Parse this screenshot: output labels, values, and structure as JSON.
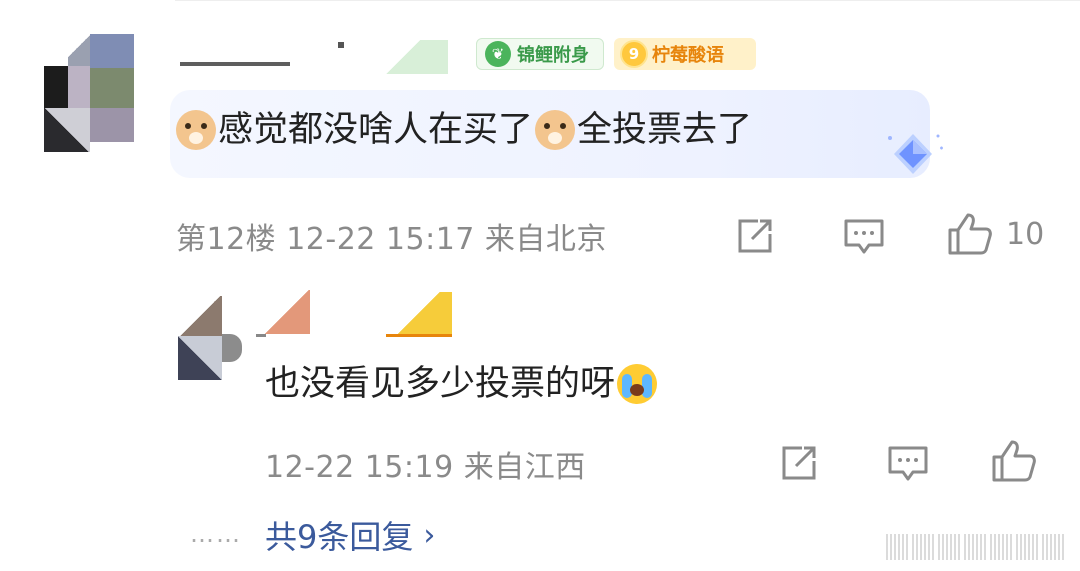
{
  "comment": {
    "badges": {
      "koi_label": "锦鲤附身",
      "koi_icon": "koi-leaf-icon",
      "lemon_level": "9",
      "lemon_label": "柠莓酸语"
    },
    "text_part1": "感觉都没啥人在买了",
    "text_part2": "全投票去了",
    "emoji": "dog-emoji",
    "meta": "第12楼 12-22 15:17 来自北京",
    "like_count": "10"
  },
  "reply": {
    "text": "也没看见多少投票的呀",
    "emoji": "loudly-crying-emoji",
    "meta": "12-22 15:19 来自江西"
  },
  "more_replies": {
    "dots": "……",
    "label": "共9条回复",
    "chevron": "›"
  },
  "colors": {
    "meta_gray": "#8a8a8a",
    "link_blue": "#3b5a9c",
    "koi_green": "#3a9a4a",
    "lemon_orange": "#e7850c",
    "bubble_bg": "#eef2ff"
  }
}
